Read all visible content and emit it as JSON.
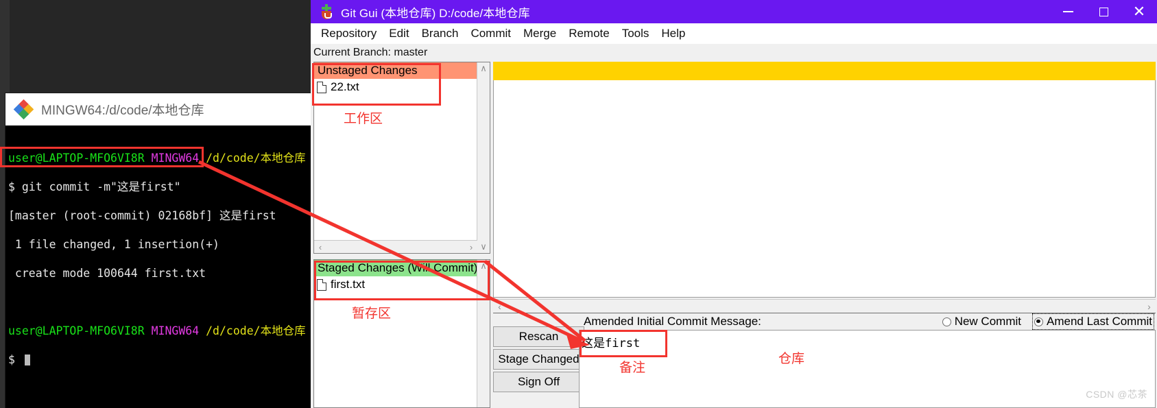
{
  "terminal": {
    "window_title": "MINGW64:/d/code/本地仓库",
    "icon": "mingw-icon",
    "lines": [
      {
        "user": "user@LAPTOP-MFO6VI8R",
        "host": "MINGW64",
        "path": "/d/code/本地仓库"
      },
      {
        "prompt": "$ ",
        "command": "git commit -m\"这是first\""
      },
      {
        "output": "[master (root-commit) 02168bf] 这是first"
      },
      {
        "output": " 1 file changed, 1 insertion(+)"
      },
      {
        "output": " create mode 100644 first.txt"
      },
      {
        "user": "user@LAPTOP-MFO6VI8R",
        "host": "MINGW64",
        "path": "/d/code/本地仓库"
      },
      {
        "prompt": "$ ",
        "command": ""
      }
    ]
  },
  "gitgui": {
    "title": "Git Gui (本地仓库) D:/code/本地仓库",
    "app_icon": "git-gui-icon",
    "window_buttons": {
      "minimize": "minimize-icon",
      "maximize": "maximize-icon",
      "close": "close-icon"
    },
    "menu": [
      "Repository",
      "Edit",
      "Branch",
      "Commit",
      "Merge",
      "Remote",
      "Tools",
      "Help"
    ],
    "branch_line": "Current Branch: master",
    "unstaged": {
      "header": "Unstaged Changes",
      "header_color": "#ff9473",
      "files": [
        "22.txt"
      ]
    },
    "staged": {
      "header": "Staged Changes (Will Commit)",
      "header_color": "#8ce38c",
      "files": [
        "first.txt"
      ]
    },
    "buttons": [
      "Rescan",
      "Stage Changed",
      "Sign Off"
    ],
    "commit_message_label": "Amended Initial Commit Message:",
    "commit_message_value": "这是first",
    "commit_mode": {
      "new_commit": "New Commit",
      "amend_last_commit": "Amend Last Commit",
      "selected": "Amend Last Commit"
    },
    "scroll_arrows": {
      "up": "∧",
      "down": "∨",
      "left": "‹",
      "right": "›"
    }
  },
  "annotations": {
    "working_area": "工作区",
    "staging_area": "暂存区",
    "message_note": "备注",
    "repository": "仓库",
    "accent_color": "#f2342e"
  },
  "watermark": "CSDN @芯茶"
}
